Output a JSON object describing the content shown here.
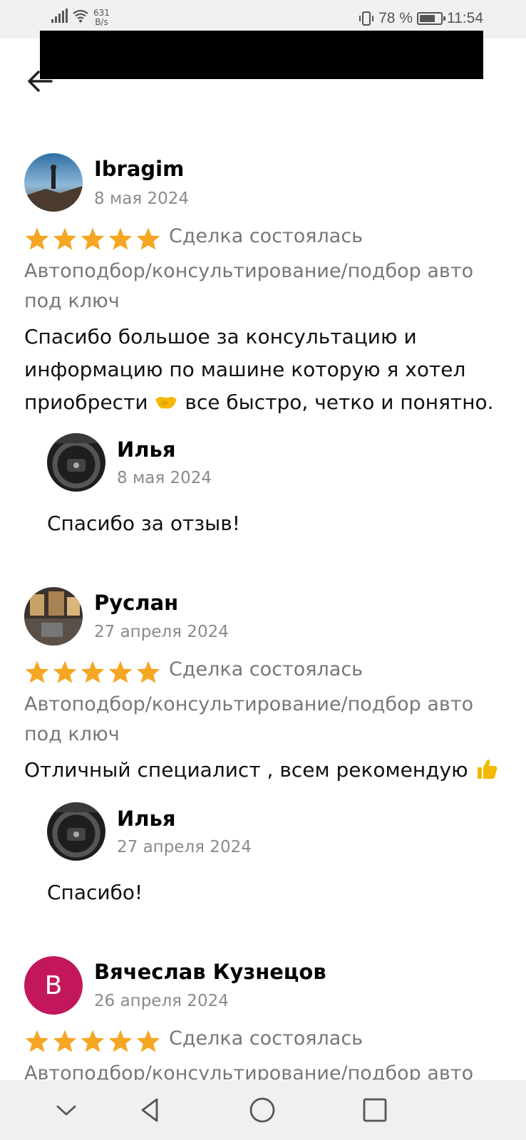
{
  "status_bar": {
    "net_speed_value": "631",
    "net_speed_unit": "B/s",
    "battery_percent": "78 %",
    "battery_level": 0.78,
    "time": "11:54"
  },
  "header": {
    "back_icon": "arrow-left-icon"
  },
  "reviews": [
    {
      "author": "Ibragim",
      "date": "8 мая 2024",
      "rating": 5,
      "deal_status": "Сделка состоялась",
      "service_line1": "Автоподбор/консультирование/подбор авто",
      "service_line2": "под ключ",
      "text_line1": "Спасибо большое за консультацию и",
      "text_line2": "информацию по машине которую я хотел",
      "text_line3a": "приобрести",
      "text_line3b": "все быстро, четко и понятно.",
      "reply": {
        "author": "Илья",
        "date": "8 мая 2024",
        "text": "Спасибо за отзыв!"
      }
    },
    {
      "author": "Руслан",
      "date": "27 апреля 2024",
      "rating": 5,
      "deal_status": "Сделка состоялась",
      "service_line1": "Автоподбор/консультирование/подбор авто",
      "service_line2": "под ключ",
      "text_line1": "Отличный специалист ,  всем рекомендую",
      "reply": {
        "author": "Илья",
        "date": "27 апреля 2024",
        "text": "Спасибо!"
      }
    },
    {
      "author": "Вячеслав Кузнецов",
      "avatar_letter": "В",
      "date": "26 апреля 2024",
      "rating": 5,
      "deal_status": "Сделка состоялась",
      "service_line1": "Автоподбор/консультирование/подбор авто"
    }
  ],
  "colors": {
    "star": "#f5a623",
    "secondary_text": "#8a8a8a",
    "avatar_letter_bg": "#c2185b"
  },
  "nav_bar": {
    "buttons": [
      "chevron-down-icon",
      "back-triangle-icon",
      "home-circle-icon",
      "recents-square-icon"
    ]
  }
}
